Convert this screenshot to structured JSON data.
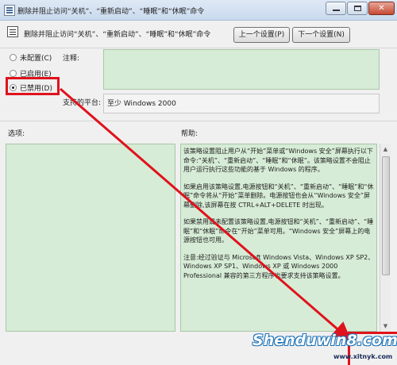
{
  "window": {
    "title": "删除并阻止访问“关机”、“重新启动”、“睡眠”和“休眠”命令"
  },
  "header": {
    "title": "删除并阻止访问“关机”、“重新启动”、“睡眠”和“休眠”命令",
    "prev_button": "上一个设置(P)",
    "next_button": "下一个设置(N)"
  },
  "state_options": [
    {
      "label": "未配置(C)",
      "checked": false
    },
    {
      "label": "已启用(E)",
      "checked": false
    },
    {
      "label": "已禁用(D)",
      "checked": true
    }
  ],
  "comment": {
    "label": "注释:",
    "value": ""
  },
  "platform": {
    "label": "支持的平台:",
    "value": "至少 Windows 2000"
  },
  "options": {
    "label": "选项:"
  },
  "help": {
    "label": "帮助:",
    "paragraphs": [
      "该策略设置阻止用户从“开始”菜单或“Windows 安全”屏幕执行以下命令:“关机”、“重新启动”、“睡眠”和“休眠”。该策略设置不会阻止用户运行执行这些功能的基于 Windows 的程序。",
      "如果启用该策略设置,电源按钮和“关机”、“重新启动”、“睡眠”和“休眠”命令将从“开始”菜单删除。电源按钮也会从“Windows 安全”屏幕删除,该屏幕在按 CTRL+ALT+DELETE 时出现。",
      "如果禁用或未配置该策略设置,电源按钮和“关机”、“重新启动”、“睡眠”和“休眠”命令在“开始”菜单可用。“Windows 安全”屏幕上的电源按钮也可用。",
      "注意:经过验证与 Microsoft Windows Vista、Windows XP SP2、Windows XP SP1、Windows XP 或 Windows 2000 Professional 兼容的第三方程序也要求支持该策略设置。"
    ]
  },
  "watermark": {
    "text": "Shenduwin8.com",
    "url": "www.xitnyk.com"
  },
  "colors": {
    "panel_bg": "#d6ecd6",
    "annotation_red": "#e0121c"
  }
}
